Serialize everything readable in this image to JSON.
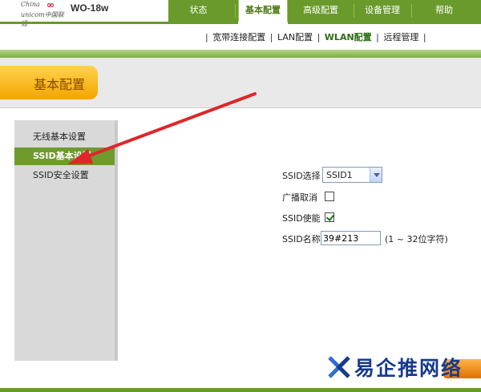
{
  "brand": {
    "logo_china": "China",
    "logo_unicom": "unicom中国联通",
    "model": "WO-18w"
  },
  "top_nav": [
    "状态",
    "基本配置",
    "高级配置",
    "设备管理",
    "帮助"
  ],
  "top_nav_active": "基本配置",
  "sub_nav": [
    "宽带连接配置",
    "LAN配置",
    "WLAN配置",
    "远程管理"
  ],
  "sub_nav_active": "WLAN配置",
  "section_title": "基本配置",
  "left_nav": [
    "无线基本设置",
    "SSID基本设置",
    "SSID安全设置"
  ],
  "left_nav_active": "SSID基本设置",
  "form": {
    "ssid_select_label": "SSID选择",
    "ssid_select_value": "SSID1",
    "broadcast_label": "广播取消",
    "broadcast_checked": false,
    "enable_label": "SSID使能",
    "enable_checked": true,
    "name_label": "SSID名称",
    "name_value": "39#213",
    "name_hint": "(1 ~ 32位字符)"
  },
  "watermark": "易企推网络",
  "colors": {
    "nav_green": "#6a9a2b",
    "active_left": "#6f9a2e",
    "section_orange": "#f3a500",
    "arrow_red": "#e0262a"
  }
}
